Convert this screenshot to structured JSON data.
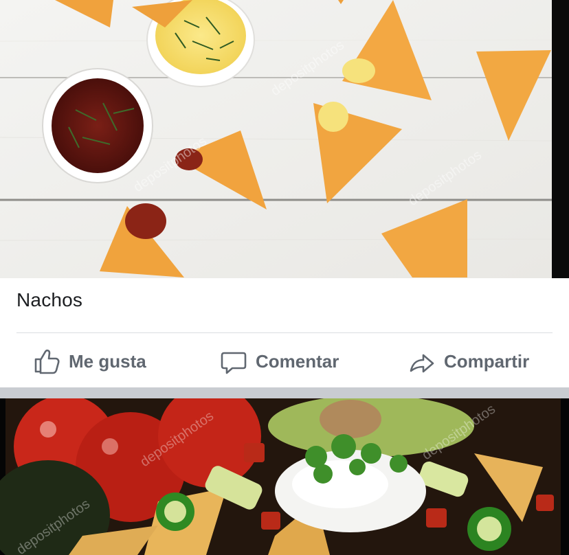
{
  "post1": {
    "caption": "Nachos",
    "image_alt": "nachos with salsa and cheese dip",
    "watermark": "depositphotos"
  },
  "actions": {
    "like": "Me gusta",
    "comment": "Comentar",
    "share": "Compartir"
  },
  "post2": {
    "image_alt": "loaded nachos with sour cream and jalapeños",
    "watermark": "depositphotos"
  },
  "colors": {
    "action_text": "#606770",
    "divider": "#dadde1",
    "feed_separator": "#c9ccd1"
  }
}
